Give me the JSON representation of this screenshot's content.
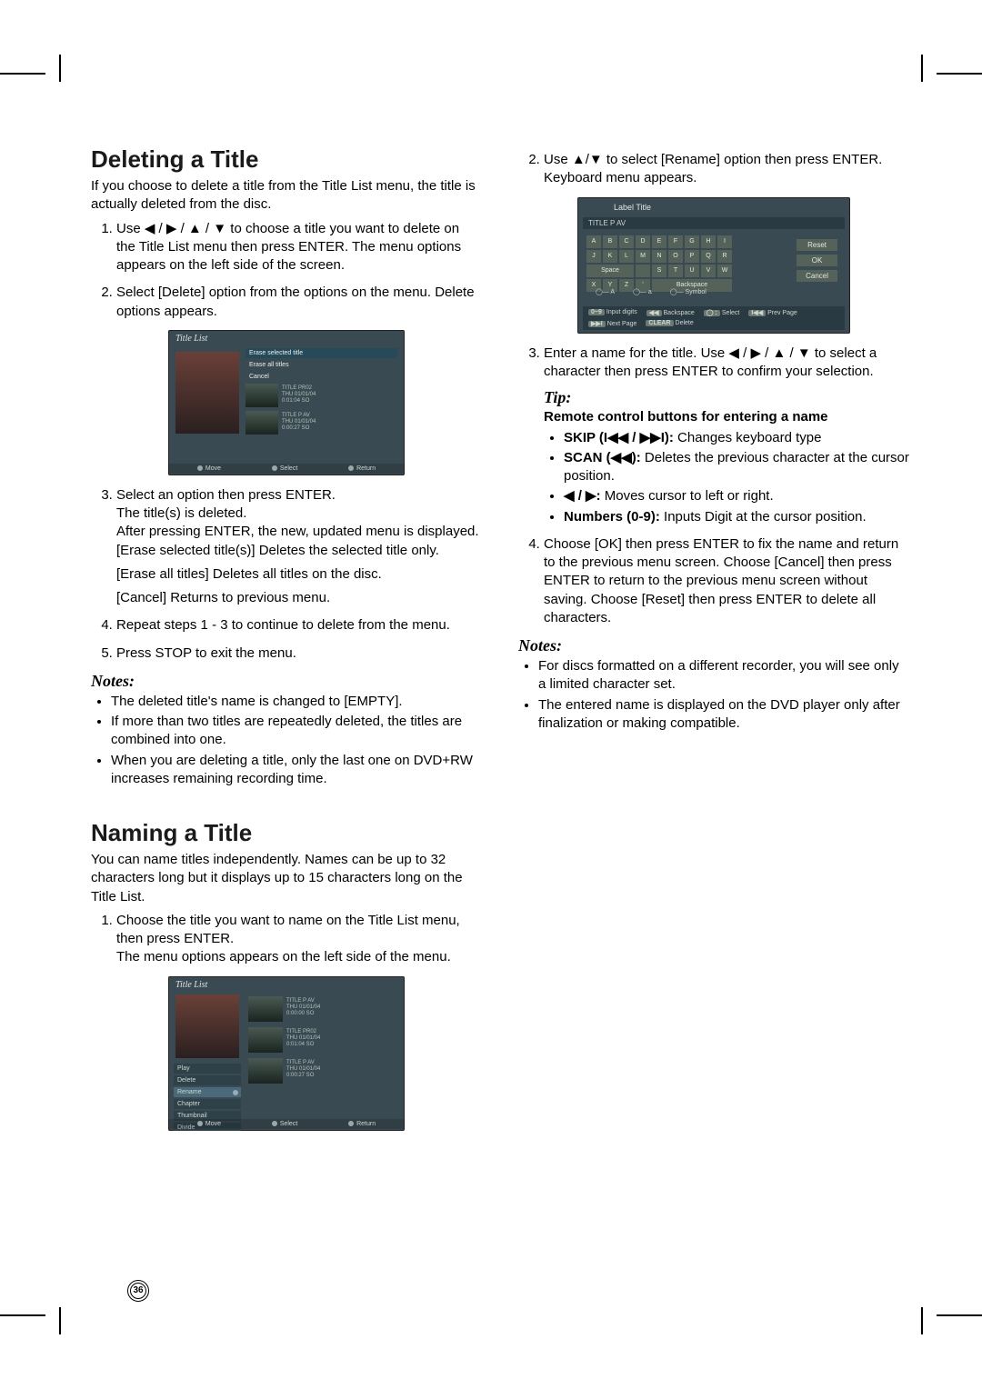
{
  "page_number": "36",
  "left": {
    "h_delete": "Deleting a Title",
    "p_delete_intro": "If you choose to delete a title from the Title List menu, the title is actually deleted from the disc.",
    "ol_delete": [
      "Use ◀ / ▶ / ▲ / ▼ to choose a title you want to delete on the Title List menu then press ENTER. The menu options appears on the left side of the screen.",
      "Select [Delete] option from the options on the menu. Delete options appears."
    ],
    "fig1": {
      "title": "Title List",
      "menu_items": [
        "Erase selected title",
        "Erase all titles",
        "Cancel"
      ],
      "rows": [
        {
          "name": "TITLE PR02",
          "date": "THU 01/01/04",
          "len": "0:01:04 SO"
        },
        {
          "name": "TITLE P AV",
          "date": "THU 01/01/04",
          "len": "0:00:27 SO"
        }
      ],
      "footer": [
        "Move",
        "Select",
        "Return"
      ]
    },
    "ol_delete_cont": [
      {
        "head": "Select an option then press ENTER.",
        "lines": [
          "The title(s) is deleted.",
          "After pressing ENTER, the new, updated menu is displayed.",
          "[Erase selected title(s)] Deletes the selected title only.",
          "[Erase all titles] Deletes all titles on the disc.",
          "[Cancel] Returns to previous menu."
        ]
      },
      {
        "head": "Repeat steps 1 - 3 to continue to delete from the menu."
      },
      {
        "head": "Press STOP to exit the menu."
      }
    ],
    "notes_label": "Notes:",
    "notes": [
      "The deleted title's name is changed to [EMPTY].",
      "If more than two titles are repeatedly deleted, the titles are combined into one.",
      "When you are deleting a title, only the last one on DVD+RW increases remaining recording time."
    ],
    "h_name": "Naming a Title",
    "p_name_intro": "You can name titles independently. Names can be up to 32 characters long but it displays up to 15 characters long on the Title List.",
    "ol_name": [
      "Choose the title you want to name on the Title List menu, then press ENTER.\nThe menu options appears on the left side of the menu."
    ],
    "fig2": {
      "title": "Title List",
      "side": [
        "Play",
        "Delete",
        "Rename",
        "Chapter",
        "Thumbnail",
        "Divide"
      ],
      "side_selected_index": 2,
      "rows": [
        {
          "name": "TITLE P AV",
          "date": "THU 01/01/04",
          "len": "0:00:00 SO"
        },
        {
          "name": "TITLE PR02",
          "date": "THU 01/01/04",
          "len": "0:01:04 SO"
        },
        {
          "name": "TITLE P AV",
          "date": "THU 01/01/04",
          "len": "0:00:27 SO"
        }
      ],
      "footer": [
        "Move",
        "Select",
        "Return"
      ]
    }
  },
  "right": {
    "ol_name_cont": [
      "Use ▲/▼ to select [Rename] option then press ENTER.\nKeyboard menu appears."
    ],
    "figk": {
      "header": "Label Title",
      "field": "TITLE P AV",
      "keys_row1": [
        "A",
        "B",
        "C",
        "D",
        "E",
        "F",
        "G",
        "H",
        "I"
      ],
      "keys_row2": [
        "J",
        "K",
        "L",
        "M",
        "N",
        "O",
        "P",
        "Q",
        "R"
      ],
      "keys_row3_left": "Space",
      "keys_row3_mid": [
        "S",
        "T",
        "U",
        "V",
        "W"
      ],
      "keys_row4_left": [
        "X",
        "Y",
        "Z",
        "'"
      ],
      "keys_row4_right": "Backspace",
      "buttons": [
        "Reset",
        "OK",
        "Cancel"
      ],
      "legend": [
        "◯— A",
        "◯— a",
        "◯— Symbol"
      ],
      "footer": [
        {
          "k": "0~9",
          "v": "Input digits"
        },
        {
          "k": "◀◀",
          "v": "Backspace"
        },
        {
          "k": "◯ :",
          "v": "Select"
        },
        {
          "k": "I◀◀",
          "v": "Prev Page"
        },
        {
          "k": "▶▶I",
          "v": "Next Page"
        },
        {
          "k": "CLEAR",
          "v": "Delete"
        }
      ]
    },
    "ol_name_3": "Enter a name for the title. Use ◀ / ▶ / ▲ / ▼ to select a character then press ENTER to confirm your selection.",
    "tip_label": "Tip:",
    "tip_heading": "Remote control buttons for entering a name",
    "tips": [
      {
        "b": "SKIP (I◀◀ / ▶▶I):",
        "t": " Changes keyboard type"
      },
      {
        "b": "SCAN (◀◀):",
        "t": " Deletes the previous character at the cursor position."
      },
      {
        "b": "◀ / ▶:",
        "t": " Moves cursor to left or right."
      },
      {
        "b": "Numbers (0-9):",
        "t": " Inputs Digit at the cursor position."
      }
    ],
    "ol_name_4": "Choose [OK] then press ENTER to fix the name and return to the previous menu screen. Choose [Cancel] then press ENTER to return to the previous menu screen without saving. Choose [Reset] then press ENTER to delete all characters.",
    "notes_label": "Notes:",
    "notes": [
      "For discs formatted on a different recorder, you will see only a limited character set.",
      "The entered name is displayed on the DVD player only after finalization or making compatible."
    ]
  }
}
